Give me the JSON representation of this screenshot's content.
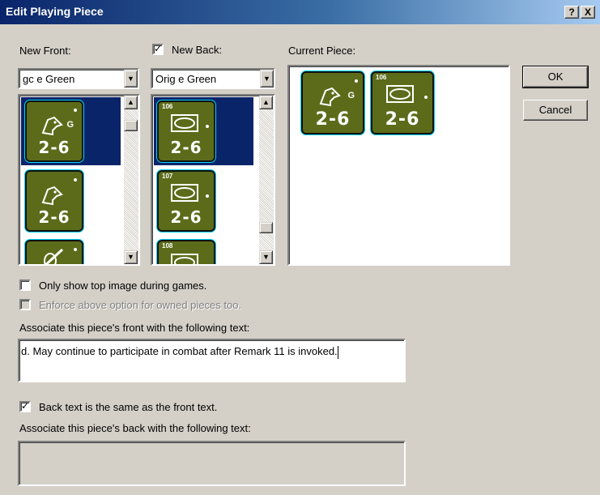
{
  "window": {
    "title": "Edit Playing Piece",
    "help_btn": "?",
    "close_btn": "X"
  },
  "front": {
    "label": "New Front:",
    "selected": "gc e Green",
    "pieces": [
      {
        "value": "2-6",
        "letter": "G",
        "icon": "horse-head-icon",
        "selected": true
      },
      {
        "value": "2-6",
        "letter": "",
        "icon": "horse-head-icon",
        "selected": false
      },
      {
        "value": "",
        "letter": "",
        "icon": "cavalry-sword-icon",
        "selected": false
      }
    ]
  },
  "back": {
    "checkbox_label": "New Back:",
    "checked": true,
    "selected": "Orig e Green",
    "pieces": [
      {
        "num": "106",
        "value": "2-6",
        "icon": "oval-frame-icon",
        "selected": true
      },
      {
        "num": "107",
        "value": "2-6",
        "icon": "oval-frame-icon",
        "selected": false
      },
      {
        "num": "108",
        "value": "",
        "icon": "oval-frame-icon",
        "selected": false
      }
    ]
  },
  "current": {
    "label": "Current Piece:",
    "front": {
      "value": "2-6",
      "letter": "G"
    },
    "back": {
      "num": "106",
      "value": "2-6"
    }
  },
  "buttons": {
    "ok": "OK",
    "cancel": "Cancel"
  },
  "options": {
    "only_top": "Only show top image during games.",
    "only_top_checked": false,
    "enforce": "Enforce above option for owned pieces too.",
    "enforce_checked": false
  },
  "front_text": {
    "label": "Associate this piece's front with the following text:",
    "value": "d. May continue to participate in combat after Remark 11 is invoked."
  },
  "back_same": {
    "label": "Back text is the same as the front text.",
    "checked": true
  },
  "back_text": {
    "label": "Associate this piece's back with the following text:",
    "value": ""
  },
  "colors": {
    "title_bar": "#0a246a",
    "face": "#d4d0c8",
    "counter_green": "#5c6b1a",
    "selection": "#0a246a",
    "counter_outline": "#00d5ff"
  }
}
